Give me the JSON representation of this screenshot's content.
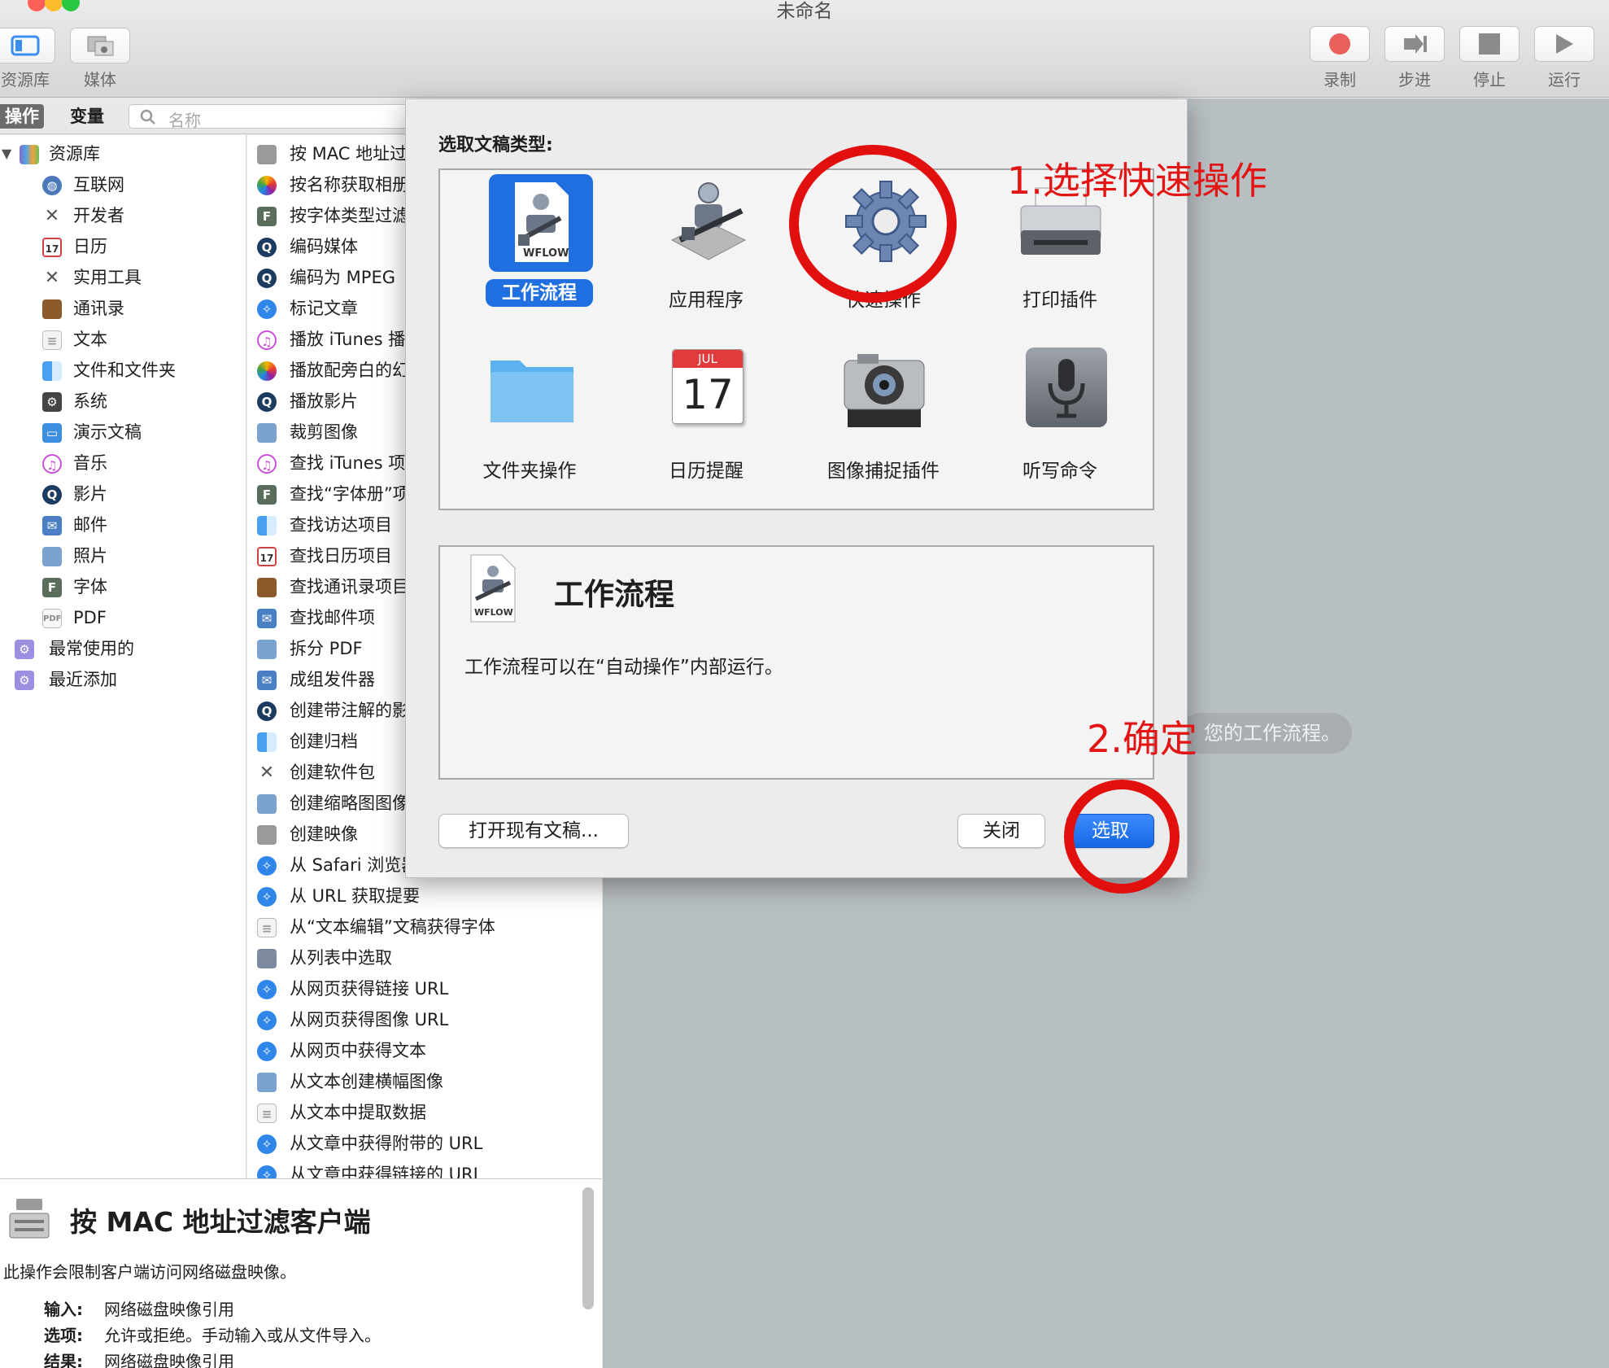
{
  "window": {
    "title": "未命名"
  },
  "toolbar": {
    "library_label": "资源库",
    "media_label": "媒体",
    "record_label": "录制",
    "step_label": "步进",
    "stop_label": "停止",
    "run_label": "运行"
  },
  "library": {
    "tab_actions": "操作",
    "tab_variables": "变量",
    "search_placeholder": "名称",
    "root": "资源库",
    "categories": [
      "互联网",
      "开发者",
      "日历",
      "实用工具",
      "通讯录",
      "文本",
      "文件和文件夹",
      "系统",
      "演示文稿",
      "音乐",
      "影片",
      "邮件",
      "照片",
      "字体",
      "PDF"
    ],
    "smart_groups": [
      "最常使用的",
      "最近添加"
    ]
  },
  "actions": [
    "按 MAC 地址过滤客户端",
    "按名称获取相册",
    "按字体类型过滤字体",
    "编码媒体",
    "编码为 MPEG",
    "标记文章",
    "播放 iTunes 播放列表",
    "播放配旁白的幻灯片",
    "播放影片",
    "裁剪图像",
    "查找 iTunes 项目",
    "查找“字体册”项目",
    "查找访达项目",
    "查找日历项目",
    "查找通讯录项目",
    "查找邮件项",
    "拆分 PDF",
    "成组发件器",
    "创建带注解的影片",
    "创建归档",
    "创建软件包",
    "创建缩略图图像",
    "创建映像",
    "从 Safari 浏览器获取网页",
    "从 URL 获取提要",
    "从“文本编辑”文稿获得字体",
    "从列表中选取",
    "从网页获得链接 URL",
    "从网页获得图像 URL",
    "从网页中获得文本",
    "从文本创建横幅图像",
    "从文本中提取数据",
    "从文章中获得附带的 URL",
    "从文章中获得链接的 URL"
  ],
  "description": {
    "title": "按 MAC 地址过滤客户端",
    "text": "此操作会限制客户端访问网络磁盘映像。",
    "input_key": "输入:",
    "input_value": "网络磁盘映像引用",
    "options_key": "选项:",
    "options_value": "允许或拒绝。手动输入或从文件导入。",
    "result_key": "结果:",
    "result_value": "网络磁盘映像引用"
  },
  "workflow_hint": "您的工作流程。",
  "sheet": {
    "heading": "选取文稿类型:",
    "types": [
      {
        "label": "工作流程",
        "icon": "workflow-icon",
        "selected": true
      },
      {
        "label": "应用程序",
        "icon": "application-icon",
        "selected": false
      },
      {
        "label": "快速操作",
        "icon": "gear-icon",
        "selected": false
      },
      {
        "label": "打印插件",
        "icon": "printer-icon",
        "selected": false
      },
      {
        "label": "文件夹操作",
        "icon": "folder-icon",
        "selected": false
      },
      {
        "label": "日历提醒",
        "icon": "calendar-icon",
        "selected": false
      },
      {
        "label": "图像捕捉插件",
        "icon": "camera-icon",
        "selected": false
      },
      {
        "label": "听写命令",
        "icon": "microphone-icon",
        "selected": false
      }
    ],
    "calendar_month": "JUL",
    "calendar_day": "17",
    "wflow_badge": "WFLOW",
    "detail_title": "工作流程",
    "detail_text": "工作流程可以在“自动操作”内部运行。",
    "open_existing": "打开现有文稿...",
    "close": "关闭",
    "choose": "选取"
  },
  "annotations": {
    "step1": "1.选择快速操作",
    "step2": "2.确定"
  },
  "colors": {
    "accent": "#1f6fe0",
    "annotation": "#e21414"
  }
}
